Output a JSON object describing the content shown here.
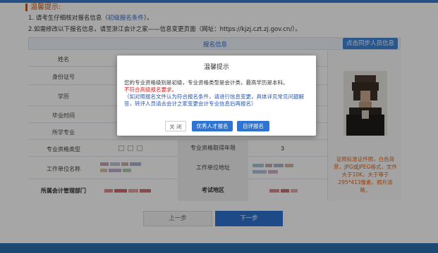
{
  "tips": {
    "title": "温馨提示:",
    "line1_prefix": "1. 请考生仔细核对报名信息（",
    "line1_link": "初级报名条件",
    "line1_suffix": "）。",
    "line2": "2.如需修改以下报名信息，请至浙江会计之家——信息变更页面（网址：https://kjzj.czt.zj.gov.cn/）。"
  },
  "form": {
    "header_title": "报名信息",
    "sync_button": "点击同步人员信息",
    "labels": {
      "name": "姓名",
      "id_card": "身份证号",
      "education": "学历",
      "grad_time": "毕业时间",
      "major": "所学专业",
      "qual_type": "专业资格类型",
      "qual_year": "专业资格取得年限",
      "employer": "工作单位名称",
      "employer_addr": "工作单位地址",
      "dept": "所属会计管理部门",
      "exam_area": "考试地区"
    },
    "qual_year_value": "3",
    "photo_note": "证照标准证件照，白色背景，JPG或JPEG格式，文件大于10K，大于等于295*413像素，照片清晰。"
  },
  "buttons": {
    "prev": "上一步",
    "next": "下一步"
  },
  "modal": {
    "title": "温馨提示",
    "line1": "您的专业资格级别是初级，专业资格类型是会计类，最高学历是本科。",
    "line2": "不符合高级报名要求。",
    "line3": "（如对照报名文件认为符合报名条件，请进行信息变更，具体详见常见问题解答，转评人员请去会计之家变更会计专业信息后再报名）",
    "close": "关 闭",
    "btn_talent": "优秀人才报名",
    "btn_review": "自评报名"
  },
  "colors": {
    "accent": "#2f74d0",
    "warning": "#e0651a",
    "error": "#e02020",
    "note_blue": "#2a55b0"
  }
}
